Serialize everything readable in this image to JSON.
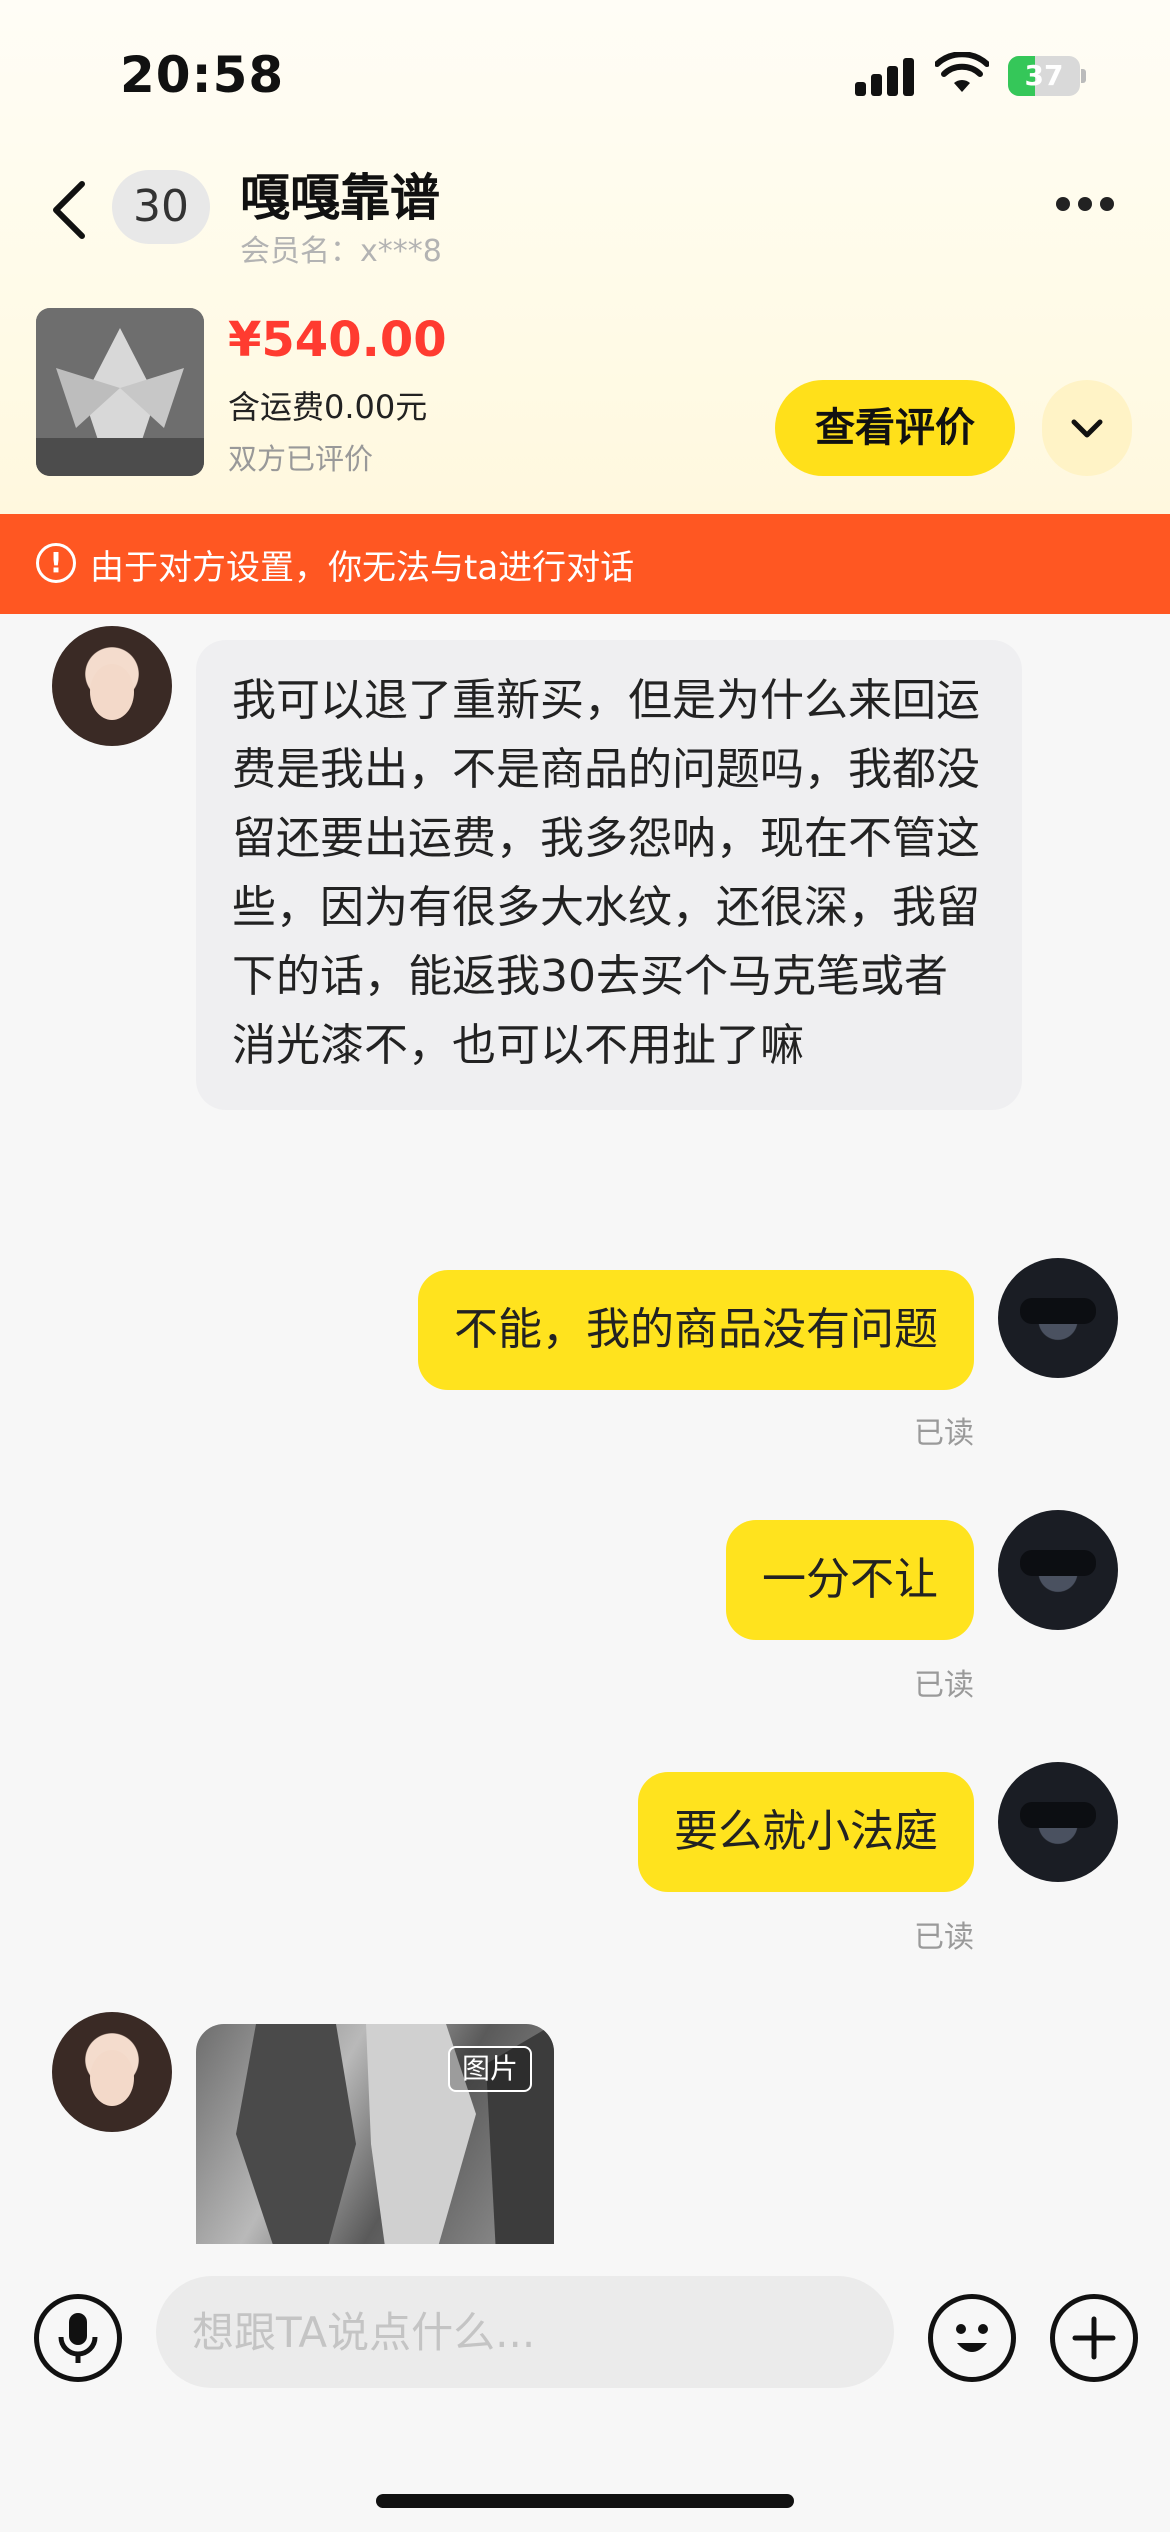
{
  "status_bar": {
    "time": "20:58",
    "battery": "37",
    "battery_level": 0.37
  },
  "header": {
    "unread_count": "30",
    "title": "嘎嘎靠谱",
    "member_name": "会员名：x***8"
  },
  "product": {
    "price": "¥540.00",
    "shipping": "含运费0.00元",
    "rating_status": "双方已评价",
    "review_button": "查看评价"
  },
  "warning": {
    "text": "由于对方设置，你无法与ta进行对话"
  },
  "messages": [
    {
      "from": "other",
      "text": "我可以退了重新买，但是为什么来回运费是我出，不是商品的问题吗，我都没留还要出运费，我多怨呐，现在不管这些，因为有很多大水纹，还很深，我留下的话，能返我30去买个马克笔或者消光漆不，也可以不用扯了嘛"
    },
    {
      "from": "me",
      "text": "不能，我的商品没有问题",
      "status": "已读"
    },
    {
      "from": "me",
      "text": "一分不让",
      "status": "已读"
    },
    {
      "from": "me",
      "text": "要么就小法庭",
      "status": "已读"
    },
    {
      "from": "other",
      "type": "image",
      "tag": "图片"
    }
  ],
  "input": {
    "placeholder": "想跟TA说点什么..."
  },
  "colors": {
    "accent": "#ffe01a",
    "warning": "#ff5722",
    "price": "#ff3b30"
  }
}
